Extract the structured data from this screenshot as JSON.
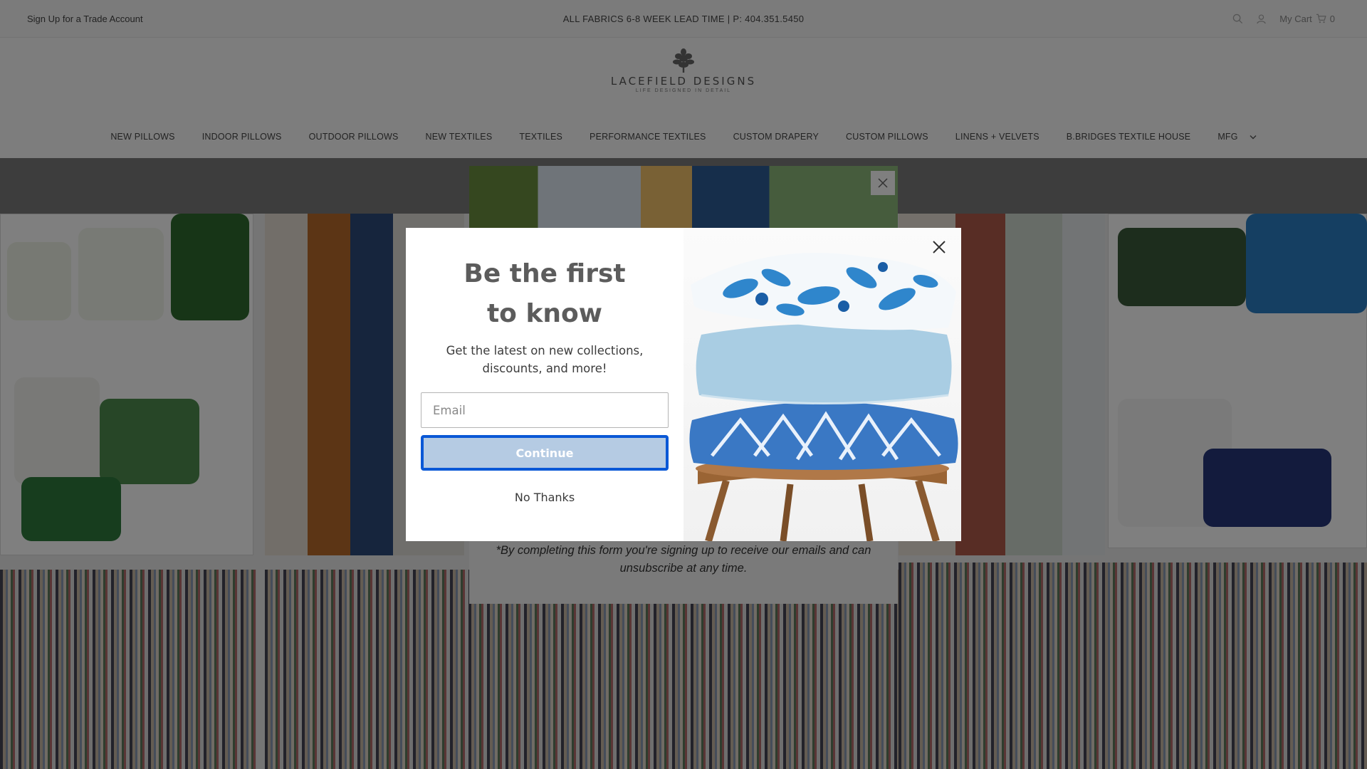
{
  "topbar": {
    "trade_link": "Sign Up for a Trade Account",
    "announcement": "ALL FABRICS 6-8 WEEK LEAD TIME | P: 404.351.5450",
    "cart_label": "My Cart",
    "cart_count": "0"
  },
  "logo": {
    "name": "LACEFIELD DESIGNS",
    "tagline": "LIFE DESIGNED IN DETAIL"
  },
  "nav": {
    "items": [
      "NEW PILLOWS",
      "INDOOR PILLOWS",
      "OUTDOOR PILLOWS",
      "NEW TEXTILES",
      "TEXTILES",
      "PERFORMANCE TEXTILES",
      "CUSTOM DRAPERY",
      "CUSTOM PILLOWS",
      "LINENS + VELVETS",
      "B.BRIDGES TEXTILE HOUSE"
    ],
    "mfg": "MFG"
  },
  "background_popup": {
    "note": "*By completing this form you're signing up to receive our emails and can unsubscribe at any time."
  },
  "modal": {
    "headline_line1": "Be the first",
    "headline_line2": "to know",
    "subtext": "Get the latest on new collections, discounts, and more!",
    "email_placeholder": "Email",
    "continue_label": "Continue",
    "no_thanks_label": "No Thanks",
    "accent_color": "#0a58d6",
    "button_color": "#b5cbe3"
  },
  "icons": {
    "search": "search-icon",
    "account": "user-icon",
    "cart": "cart-icon",
    "close": "close-icon",
    "dropdown": "chevron-down-icon"
  }
}
